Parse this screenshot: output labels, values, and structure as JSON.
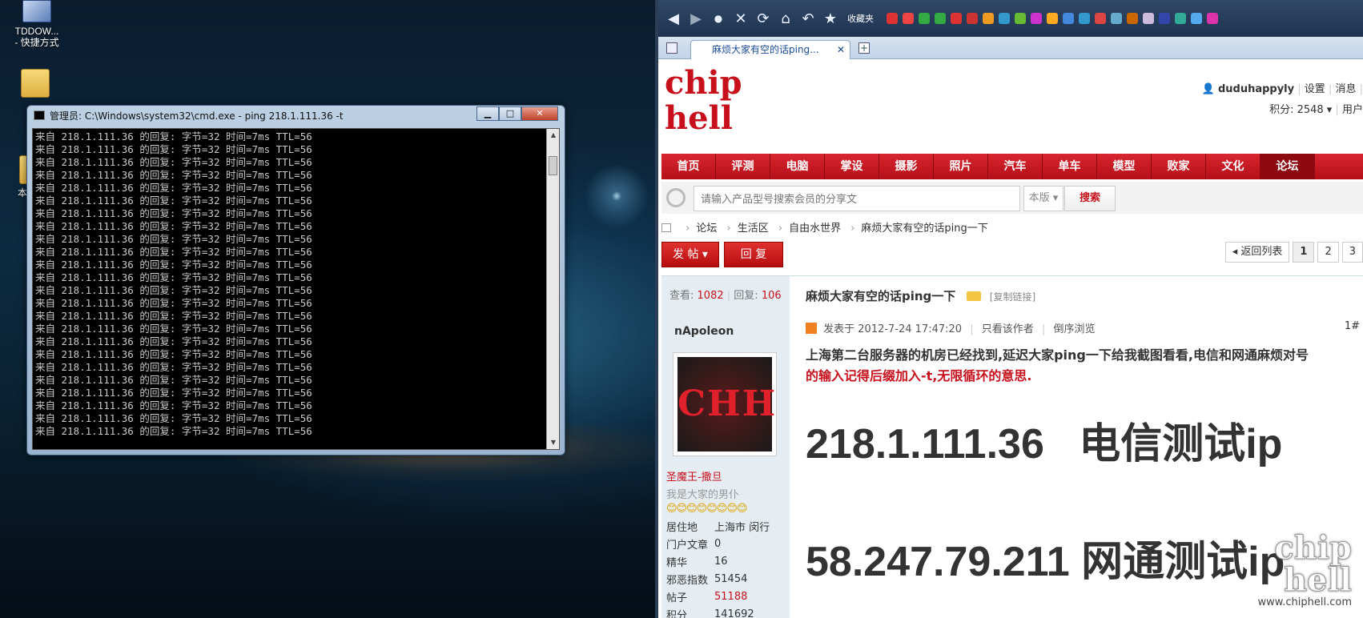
{
  "desktop": {
    "icons": [
      {
        "label": "TDDOW...\n- 快捷方式"
      },
      {
        "label": ""
      },
      {
        "label": "本"
      }
    ]
  },
  "cmd": {
    "title": "管理员: C:\\Windows\\system32\\cmd.exe - ping  218.1.111.36 -t",
    "minimize": "▁",
    "maximize": "□",
    "close": "✕",
    "line": "来自 218.1.111.36 的回复: 字节=32 时间=7ms TTL=56",
    "line_count": 24
  },
  "browser": {
    "toolbar_favorites": "收藏夹",
    "tab_title": "麻烦大家有空的话ping...",
    "tab_close": "✕",
    "new_tab": "+",
    "logo_lines": [
      "chip",
      "hell"
    ],
    "user": {
      "name": "duduhappyly",
      "links": [
        "设置",
        "消息"
      ],
      "points": "积分: 2548 ▾",
      "user_menu": "用户"
    },
    "nav": [
      "首页",
      "评测",
      "电脑",
      "掌设",
      "摄影",
      "照片",
      "汽车",
      "单车",
      "模型",
      "败家",
      "文化",
      "论坛"
    ],
    "search": {
      "placeholder": "请输入产品型号搜索会员的分享文",
      "scope": "本版 ▾",
      "button": "搜索"
    },
    "breadcrumb": [
      "论坛",
      "生活区",
      "自由水世界",
      "麻烦大家有空的话ping一下"
    ],
    "buttons": {
      "post": "发 帖 ▾",
      "reply": "回 复"
    },
    "pager": {
      "back": "◂ 返回列表",
      "pages": [
        "1",
        "2",
        "3"
      ]
    },
    "stats": {
      "views_label": "查看:",
      "views": "1082",
      "replies_label": "回复:",
      "replies": "106"
    },
    "thread_title": "麻烦大家有空的话ping一下",
    "copy_link": "[复制链接]",
    "author": {
      "name": "nApoleon",
      "avatar_text": "CHH",
      "rank": "圣魔王-撒旦",
      "motto": "我是大家的男仆",
      "smileys": "😊😊😊😊😊😊😊😊",
      "info": [
        {
          "k": "居住地",
          "v": "上海市 闵行"
        },
        {
          "k": "门户文章",
          "v": "0"
        },
        {
          "k": "精华",
          "v": "16"
        },
        {
          "k": "邪恶指数",
          "v": "51454"
        },
        {
          "k": "帖子",
          "v": "51188"
        },
        {
          "k": "积分",
          "v": "141692"
        }
      ]
    },
    "post_meta": {
      "posted": "发表于 2012-7-24 17:47:20",
      "only_author": "只看该作者",
      "reverse": "倒序浏览"
    },
    "floor": "1#",
    "post": {
      "line1": "上海第二台服务器的机房已经找到,延迟大家ping一下给我截图看看,电信和网通麻烦对号",
      "line2": "的输入记得后缀加入-t,无限循环的意思.",
      "ip1": "218.1.111.36   电信测试ip",
      "ip2": "58.247.79.211 网通测试ip"
    },
    "watermark": {
      "logo": "chip\nhell",
      "url": "www.chiphell.com"
    }
  },
  "colors": {
    "brand_red": "#c8101d",
    "console_bg": "#000000",
    "console_fg": "#c8c8c8"
  }
}
